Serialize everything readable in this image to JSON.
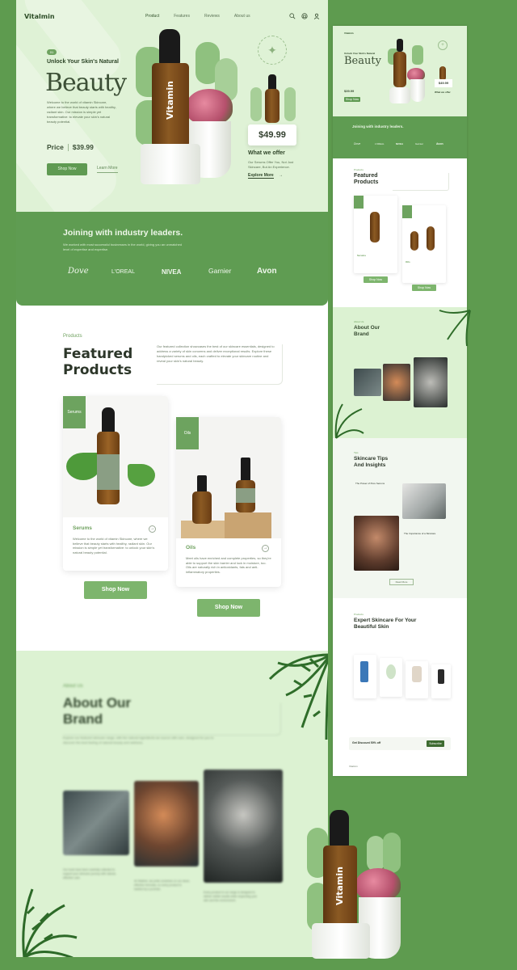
{
  "brand": "Vitalmin",
  "nav": {
    "links": [
      "Product",
      "Features",
      "Reviews",
      "About us"
    ],
    "active_index": 0,
    "icons": [
      "search-icon",
      "bag-icon",
      "user-icon"
    ]
  },
  "hero": {
    "tag": "01",
    "pretitle": "Unlock Your Skin's Natural",
    "title": "Beauty",
    "description": "Welcome to the world of vitamin Skincare, where we believe that beauty starts with healthy, radiant skin. Our mission is simple yet transformative: to elevate your skin's natural beauty potential.",
    "price_label": "Price",
    "price_value": "$39.99",
    "shop_button": "Shop Now",
    "learn_button": "Learn More",
    "bottle_label": "Vitamin",
    "small_price": "$49.99",
    "offer_title": "What we offer",
    "offer_desc": "Our Serums Offer You, Not Just Skincare, But An Experience.",
    "offer_link": "Explore More"
  },
  "partners": {
    "title": "Joining with industry leaders.",
    "description": "We worked with most successful businesses in the world, giving you an unmatched level of expertise and expertise.",
    "brands": [
      "Dove",
      "L'OREAL",
      "NIVEA",
      "Garnier",
      "Avon"
    ]
  },
  "featured": {
    "kicker": "Products",
    "title": "Featured Products",
    "description": "Our featured collection showcases the best of our skincare essentials, designed to address a variety of skin concerns and deliver exceptional results. Explore these handpicked serums and oils, each crafted to elevate your skincare routine and reveal your skin's natural beauty.",
    "cards": [
      {
        "tag": "Serums",
        "name": "Serums",
        "desc": "Welcome to the world of vitamin Skincare, where we believe that beauty starts with healthy, radiant skin. Our mission is simple yet transformative: to unlock your skin's natural beauty potential.",
        "button": "Shop Now"
      },
      {
        "tag": "Oils",
        "name": "Oils",
        "desc": "Meet oils have enriched and complete properties, so they're able to support the skin barrier and lock in moisture, too. Oils are naturally rich in antioxidants, fats and anti-inflammatory properties.",
        "button": "Shop Now"
      }
    ]
  },
  "about": {
    "kicker": "About Us",
    "title": "About Our Brand",
    "description": "Explore our featured skincare range, with the natural ingredients we source with care, designed for you to discover the best feeling of natural beauty and wellness.",
    "col_texts": [
      "Our tools have been carefully collected to support your skincare journey with natural, effective care.",
      "At Vitalmin, we pride ourselves on our clean, effective formulas, so every product is backed by a promise.",
      "Every product in our range is designed to deliver visible results while respecting your skin and the environment."
    ]
  },
  "small": {
    "hero_title": "Beauty",
    "hero_pre": "Unlock Your Skin's Natural",
    "price": "$39.99",
    "small_price": "$49.99",
    "offer_title": "What we offer",
    "partners_title": "Joining with industry leaders.",
    "brands": [
      "Dove",
      "L'OREAL",
      "NIVEA",
      "Garnier",
      "Avon"
    ],
    "featured_kicker": "Products",
    "featured_title": "Featured Products",
    "card1_name": "Serums",
    "card2_name": "Oils",
    "shop": "Shop Now",
    "about_kicker": "About Us",
    "about_title": "About Our Brand",
    "tips_kicker": "Tips",
    "tips_title": "Skincare Tips And Insights",
    "tip1": "The Power of Pure Serums",
    "tip2": "The Importance of a Skincare",
    "read_more": "Read More",
    "expert_kicker": "Products",
    "expert_title": "Expert Skincare For Your Beautiful Skin",
    "newsletter": "Get Discount 50% off",
    "subscribe": "Subscribe",
    "footer_brand": "Vitalmin"
  }
}
